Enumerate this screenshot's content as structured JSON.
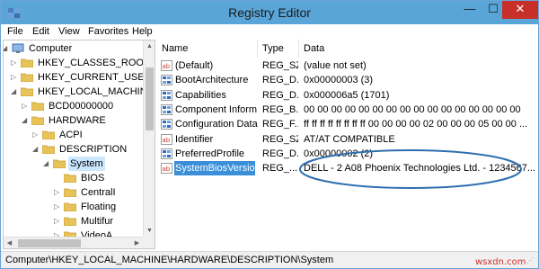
{
  "window": {
    "title": "Registry Editor",
    "minimize_glyph": "—",
    "maximize_glyph": "☐",
    "close_glyph": "✕",
    "app_icon": "registry-editor-icon"
  },
  "menu": {
    "items": [
      "File",
      "Edit",
      "View",
      "Favorites",
      "Help"
    ]
  },
  "tree": {
    "items": [
      {
        "label": "Computer",
        "icon": "computer-icon",
        "expander": "◢"
      },
      {
        "label": "HKEY_CLASSES_ROOT",
        "icon": "folder-icon",
        "expander": "▷"
      },
      {
        "label": "HKEY_CURRENT_USER",
        "icon": "folder-icon",
        "expander": "▷"
      },
      {
        "label": "HKEY_LOCAL_MACHINE",
        "icon": "folder-icon",
        "expander": "◢"
      },
      {
        "label": "BCD00000000",
        "icon": "folder-icon",
        "expander": "▷"
      },
      {
        "label": "HARDWARE",
        "icon": "folder-icon",
        "expander": "◢"
      },
      {
        "label": "ACPI",
        "icon": "folder-icon",
        "expander": "▷"
      },
      {
        "label": "DESCRIPTION",
        "icon": "folder-icon",
        "expander": "◢"
      },
      {
        "label": "System",
        "icon": "folder-icon",
        "expander": "◢",
        "selected": true
      },
      {
        "label": "BIOS",
        "icon": "folder-icon",
        "expander": ""
      },
      {
        "label": "CentralI",
        "icon": "folder-icon",
        "expander": "▷"
      },
      {
        "label": "Floating",
        "icon": "folder-icon",
        "expander": "▷"
      },
      {
        "label": "Multifur",
        "icon": "folder-icon",
        "expander": "▷"
      },
      {
        "label": "VideoA",
        "icon": "folder-icon",
        "expander": "▷"
      }
    ]
  },
  "list": {
    "headers": {
      "name": "Name",
      "type": "Type",
      "data": "Data"
    },
    "rows": [
      {
        "icon": "ab",
        "name": "(Default)",
        "type": "REG_SZ",
        "data": "(value not set)"
      },
      {
        "icon": "bin",
        "name": "BootArchitecture",
        "type": "REG_D...",
        "data": "0x00000003 (3)"
      },
      {
        "icon": "bin",
        "name": "Capabilities",
        "type": "REG_D...",
        "data": "0x000006a5 (1701)"
      },
      {
        "icon": "bin",
        "name": "Component Inform...",
        "type": "REG_B...",
        "data": "00 00 00 00 00 00 00 00 00 00 00 00 00 00 00 00"
      },
      {
        "icon": "bin",
        "name": "Configuration Data",
        "type": "REG_F...",
        "data": "ff ff ff ff ff ff ff ff 00 00 00 00 02 00 00 00 05 00 00 ..."
      },
      {
        "icon": "ab",
        "name": "Identifier",
        "type": "REG_SZ",
        "data": "AT/AT COMPATIBLE"
      },
      {
        "icon": "bin",
        "name": "PreferredProfile",
        "type": "REG_D...",
        "data": "0x00000002 (2)"
      },
      {
        "icon": "ab",
        "name": "SystemBiosVersion",
        "type": "REG_...",
        "data": "DELL   - 2 A08 Phoenix Technologies Ltd. - 1234567...",
        "selected": true
      }
    ]
  },
  "status": {
    "path": "Computer\\HKEY_LOCAL_MACHINE\\HARDWARE\\DESCRIPTION\\System"
  },
  "watermark": "wsxdn.com",
  "colors": {
    "titlebar": "#5aa5d8",
    "close": "#c7302a",
    "selection": "#3b8fd9",
    "annotation": "#2f6fb0"
  }
}
